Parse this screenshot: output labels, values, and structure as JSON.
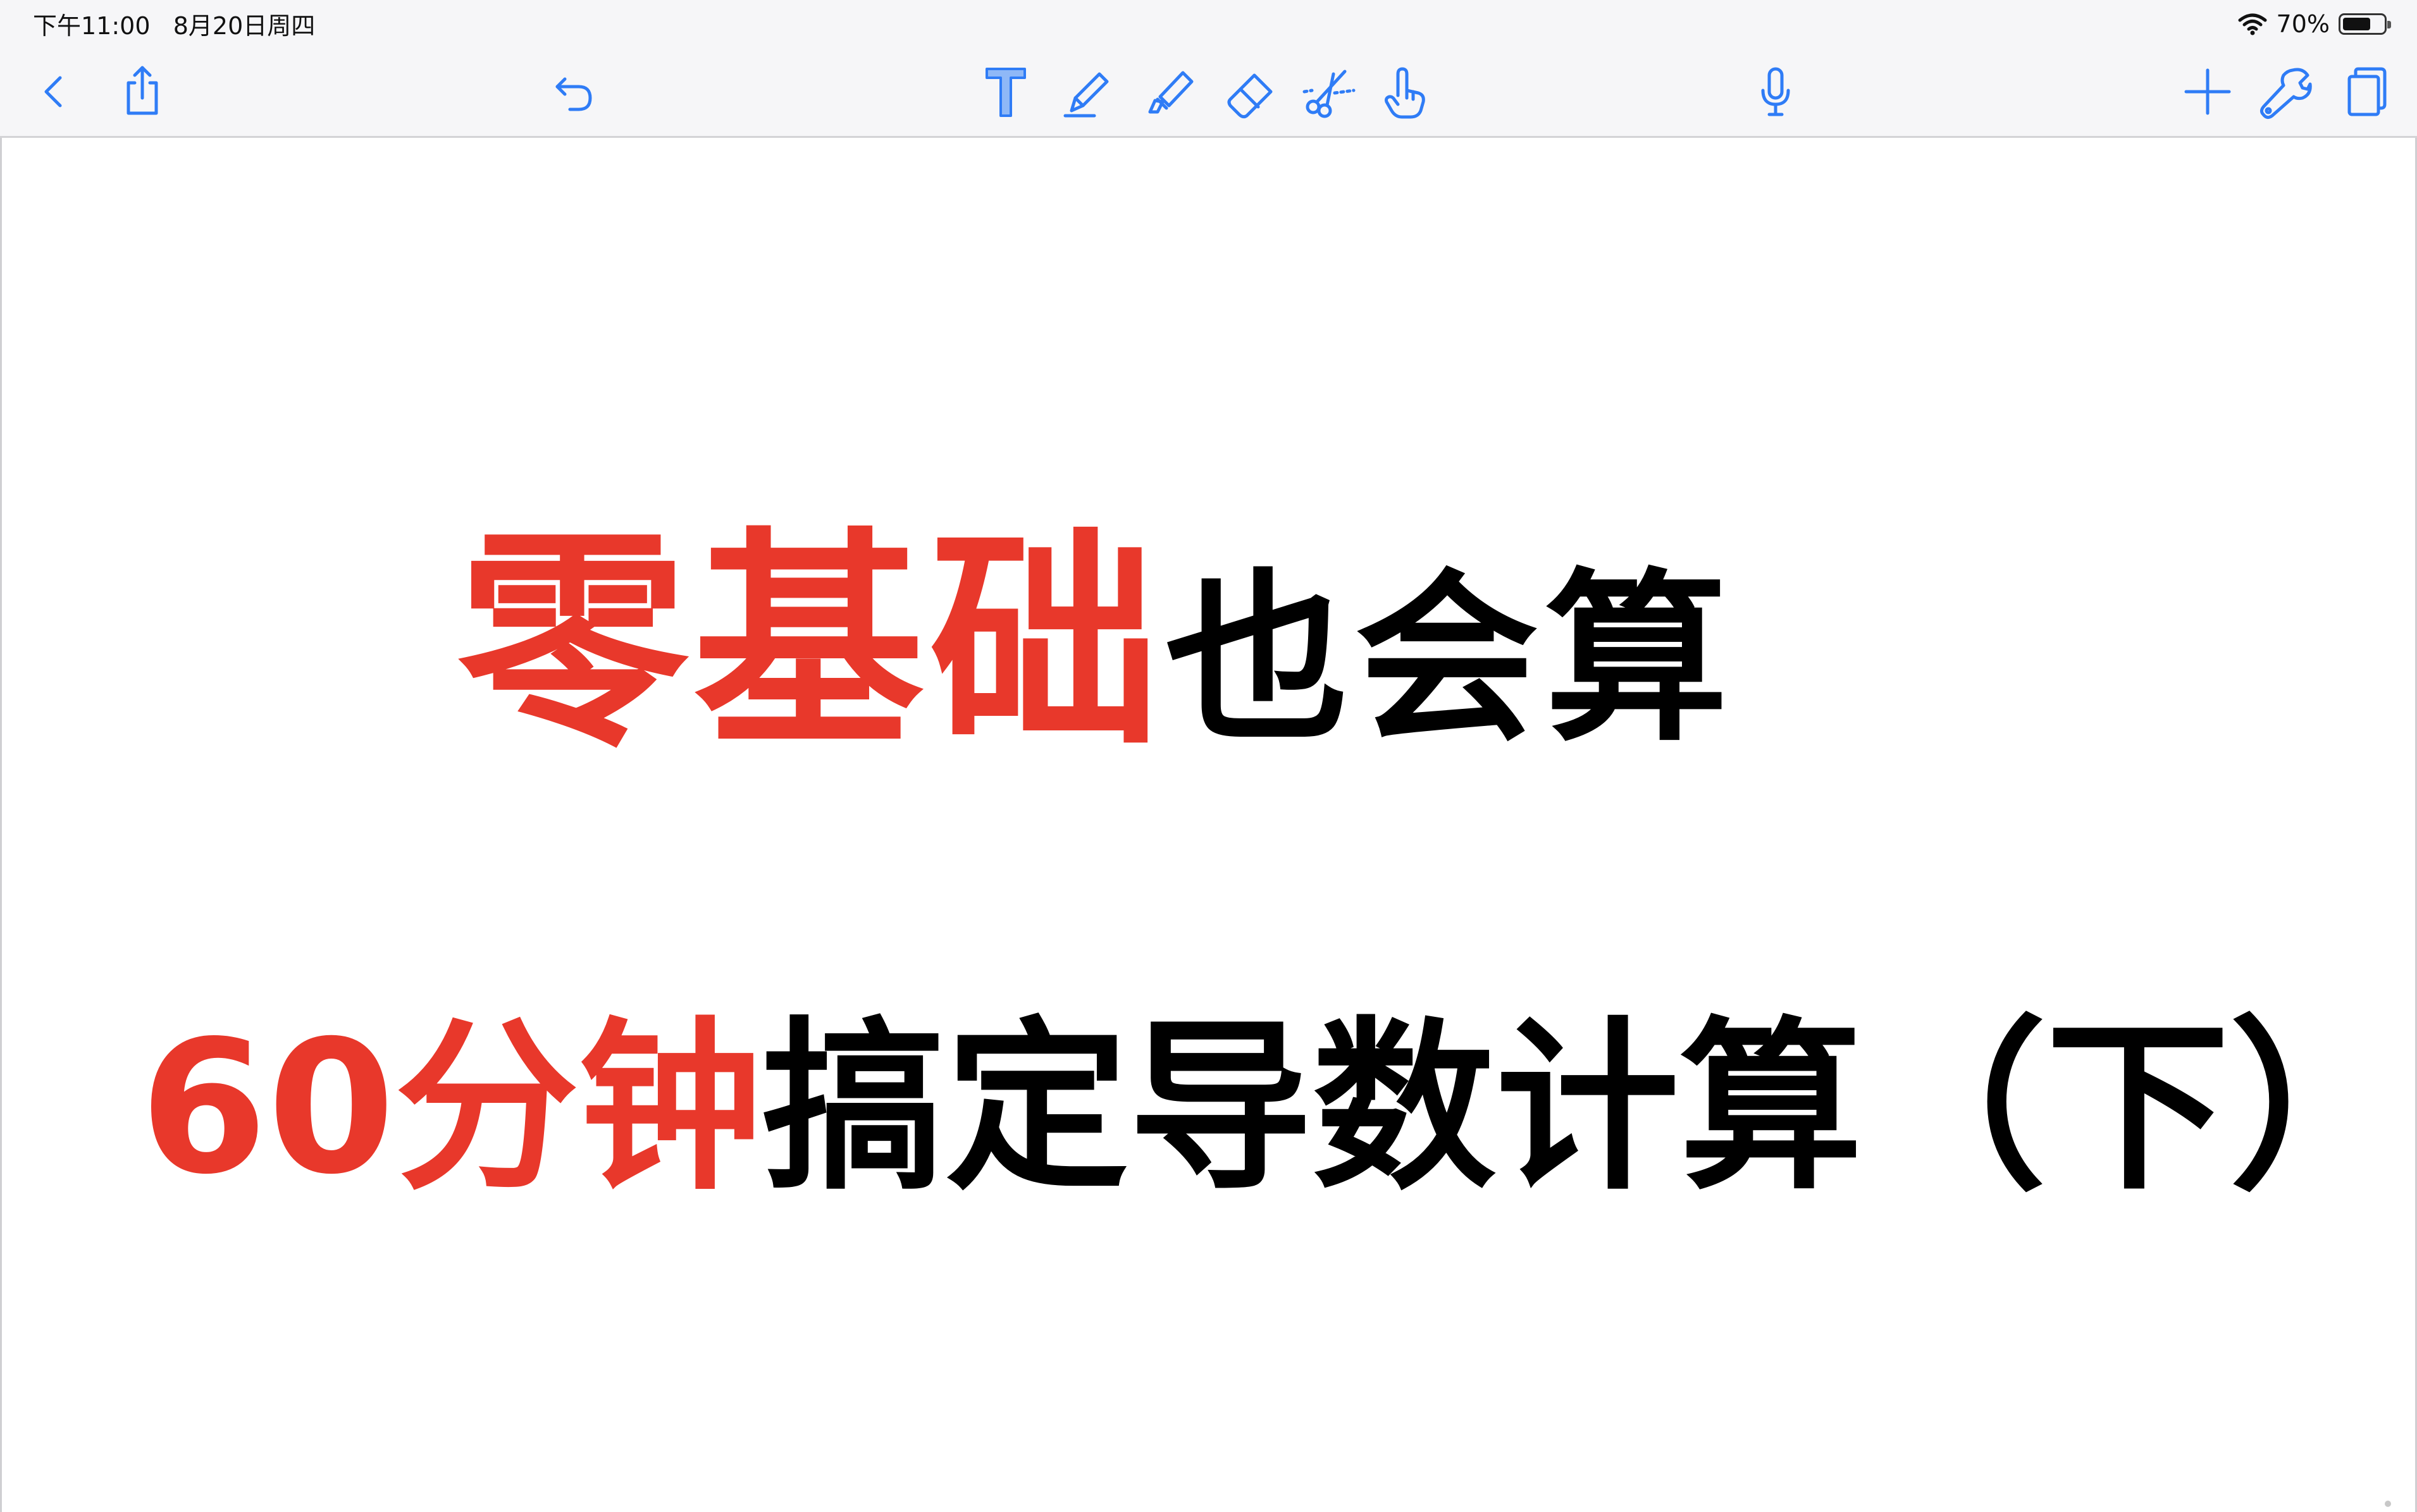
{
  "status_bar": {
    "time_date": "下午11:00   8月20日周四",
    "battery_text": "70%",
    "battery_level": 0.7
  },
  "toolbar": {
    "left": [
      {
        "name": "back-icon"
      },
      {
        "name": "share-icon"
      },
      {
        "name": "undo-icon"
      }
    ],
    "center": [
      {
        "name": "text-tool-icon"
      },
      {
        "name": "pen-tool-icon"
      },
      {
        "name": "highlighter-tool-icon"
      },
      {
        "name": "eraser-tool-icon"
      },
      {
        "name": "scissors-tool-icon"
      },
      {
        "name": "hand-pointer-icon"
      }
    ],
    "mic": {
      "name": "microphone-icon"
    },
    "right": [
      {
        "name": "add-icon"
      },
      {
        "name": "wrench-icon"
      },
      {
        "name": "pages-icon"
      }
    ],
    "accent_color": "#2f7cf6"
  },
  "document": {
    "line1": {
      "red_text": "零基础",
      "black_text": "也会算"
    },
    "line2": {
      "red_text": "60分钟",
      "black_text": "搞定导数计算（下）"
    },
    "colors": {
      "red": "#e8382b",
      "black": "#000000"
    }
  }
}
